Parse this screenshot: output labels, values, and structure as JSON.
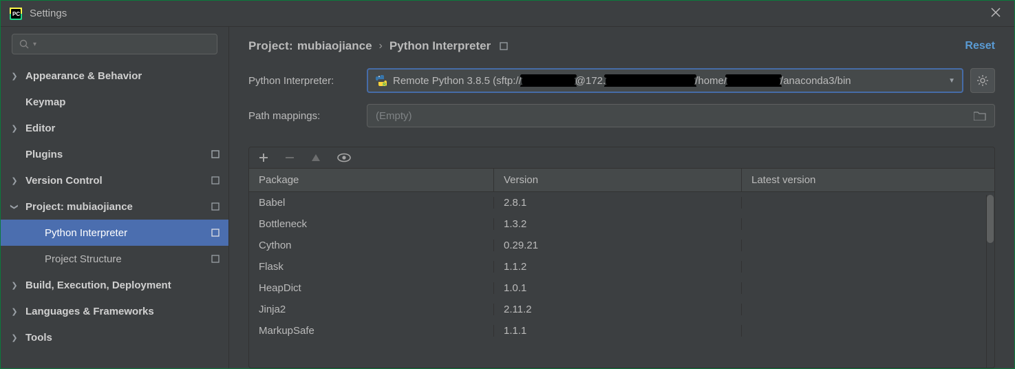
{
  "window": {
    "title": "Settings"
  },
  "search": {
    "placeholder": ""
  },
  "sidebar": {
    "items": [
      {
        "label": "Appearance & Behavior",
        "expandable": true,
        "bold": true
      },
      {
        "label": "Keymap",
        "expandable": false,
        "bold": true
      },
      {
        "label": "Editor",
        "expandable": true,
        "bold": true
      },
      {
        "label": "Plugins",
        "expandable": false,
        "bold": true,
        "modified": true
      },
      {
        "label": "Version Control",
        "expandable": true,
        "bold": true,
        "modified": true
      },
      {
        "label": "Project: mubiaojiance",
        "expandable": true,
        "expanded": true,
        "bold": true,
        "modified": true
      },
      {
        "label": "Python Interpreter",
        "sub": true,
        "selected": true,
        "modified": true
      },
      {
        "label": "Project Structure",
        "sub": true,
        "modified": true
      },
      {
        "label": "Build, Execution, Deployment",
        "expandable": true,
        "bold": true
      },
      {
        "label": "Languages & Frameworks",
        "expandable": true,
        "bold": true
      },
      {
        "label": "Tools",
        "expandable": true,
        "bold": true
      }
    ]
  },
  "breadcrumb": {
    "project_label": "Project:",
    "project_name": "mubiaojiance",
    "page": "Python Interpreter",
    "reset": "Reset"
  },
  "interp": {
    "label": "Python Interpreter:",
    "text_before": "Remote Python 3.8.5 (sftp://",
    "text_mid1": "@172.",
    "text_mid2": "/home/",
    "text_after": "/anaconda3/bin"
  },
  "pathmap": {
    "label": "Path mappings:",
    "value": "(Empty)"
  },
  "table": {
    "headers": {
      "package": "Package",
      "version": "Version",
      "latest": "Latest version"
    },
    "rows": [
      {
        "package": "Babel",
        "version": "2.8.1",
        "latest": ""
      },
      {
        "package": "Bottleneck",
        "version": "1.3.2",
        "latest": ""
      },
      {
        "package": "Cython",
        "version": "0.29.21",
        "latest": ""
      },
      {
        "package": "Flask",
        "version": "1.1.2",
        "latest": ""
      },
      {
        "package": "HeapDict",
        "version": "1.0.1",
        "latest": ""
      },
      {
        "package": "Jinja2",
        "version": "2.11.2",
        "latest": ""
      },
      {
        "package": "MarkupSafe",
        "version": "1.1.1",
        "latest": ""
      }
    ]
  }
}
